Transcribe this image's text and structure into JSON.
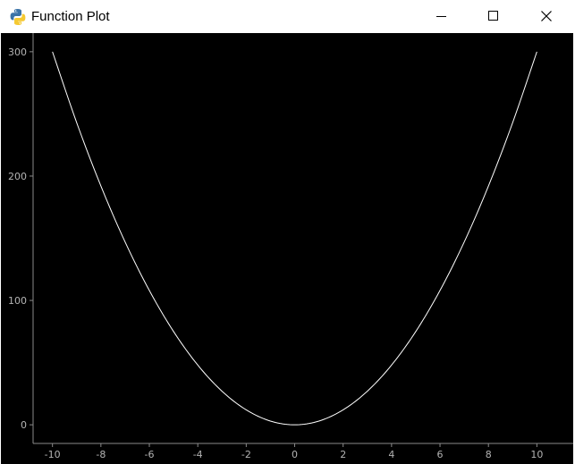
{
  "window": {
    "title": "Function Plot",
    "icon": "python-logo-icon",
    "controls": [
      "minimize-icon",
      "maximize-icon",
      "close-icon"
    ]
  },
  "colors": {
    "plot_background": "#000000",
    "curve": "#ffffff",
    "axis": "#8a8a8a",
    "tick_label": "#b4b4b4"
  },
  "chart_data": {
    "type": "line",
    "title": "",
    "xlabel": "",
    "ylabel": "",
    "xlim": [
      -10.8,
      11.5
    ],
    "ylim": [
      -15,
      315
    ],
    "x_ticks": [
      -10,
      -8,
      -6,
      -4,
      -2,
      0,
      2,
      4,
      6,
      8,
      10
    ],
    "y_ticks": [
      0,
      100,
      200,
      300
    ],
    "grid": false,
    "legend": "none",
    "series": [
      {
        "x": [
          -10,
          -9,
          -8,
          -7,
          -6,
          -5,
          -4,
          -3,
          -2,
          -1,
          0,
          1,
          2,
          3,
          4,
          5,
          6,
          7,
          8,
          9,
          10
        ],
        "y": [
          300,
          243,
          192,
          147,
          108,
          75,
          48,
          27,
          12,
          3,
          0,
          3,
          12,
          27,
          48,
          75,
          108,
          147,
          192,
          243,
          300
        ]
      }
    ]
  }
}
